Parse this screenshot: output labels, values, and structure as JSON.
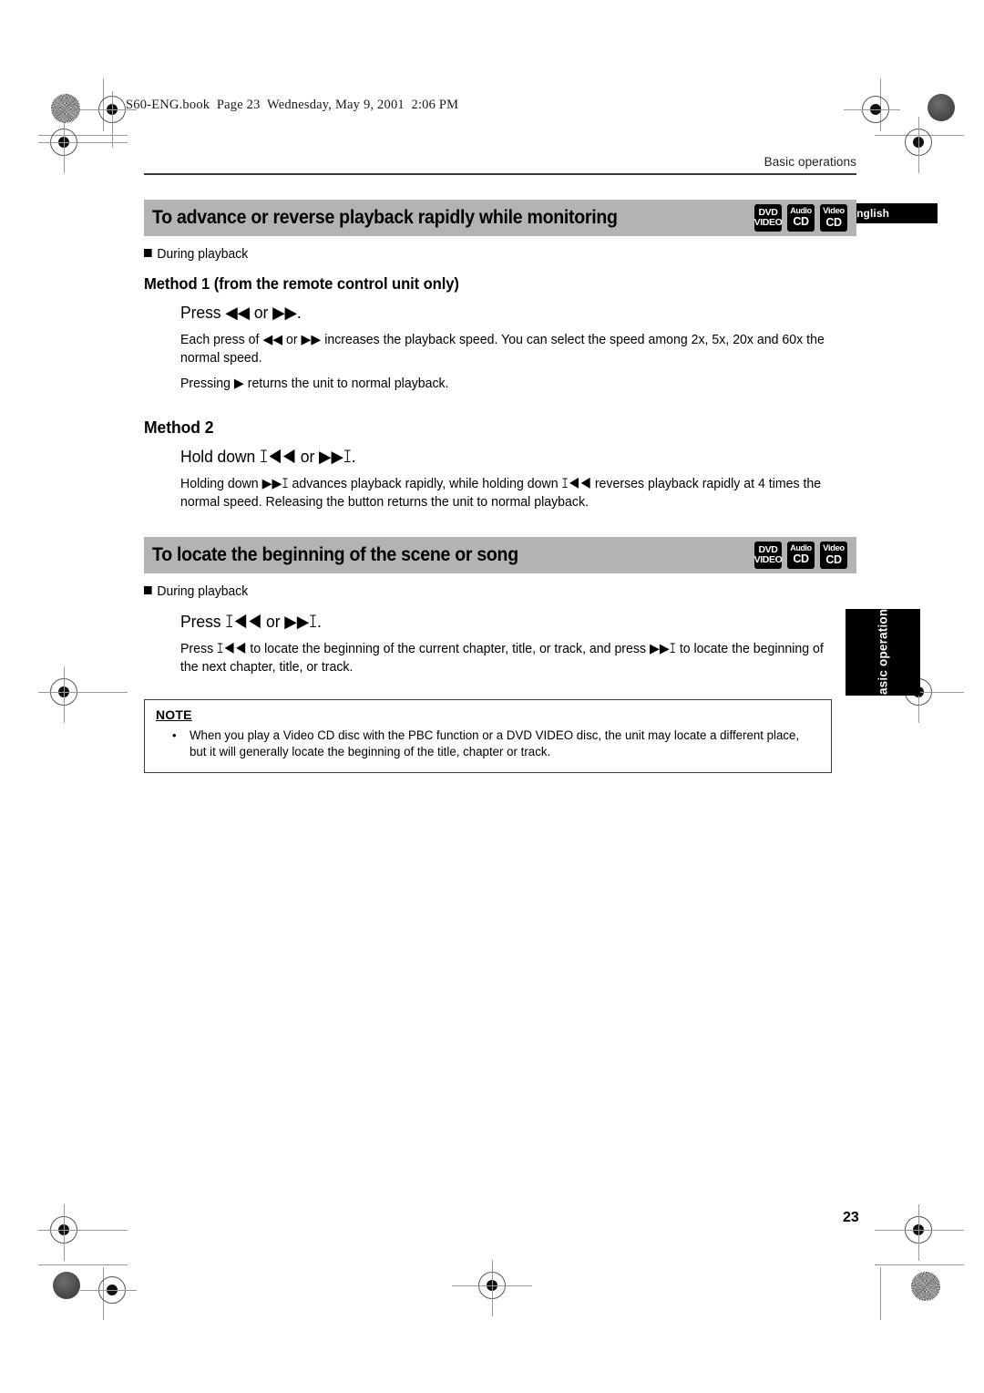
{
  "scan": {
    "header_line": "S60-ENG.book  Page 23  Wednesday, May 9, 2001  2:06 PM"
  },
  "page": {
    "running_head": "Basic operations",
    "page_number": "23",
    "language_tab": "English",
    "side_tab": "Basic operations"
  },
  "disc_icons": [
    {
      "name": "dvd-video",
      "line1": "DVD",
      "line2": "VIDEO"
    },
    {
      "name": "audio-cd",
      "line1": "Audio",
      "line2": "CD"
    },
    {
      "name": "video-cd",
      "line1": "Video",
      "line2": "CD"
    }
  ],
  "sections": [
    {
      "title": "To advance or reverse playback rapidly while monitoring",
      "condition": "During playback",
      "methods": [
        {
          "heading": "Method 1 (from the remote control unit only)",
          "step": "Press ◀◀ or ▶▶.",
          "paragraphs": [
            "Each press of ◀◀ or ▶▶ increases the playback speed. You can select the speed among 2x, 5x, 20x and 60x the normal speed.",
            "Pressing ▶ returns the unit to normal playback."
          ]
        },
        {
          "heading": "Method 2",
          "step": "Hold down ꕯ◀◀ or ▶▶ꕯ.",
          "paragraphs": [
            "Holding down ▶▶ꕯ advances playback rapidly, while holding down ꕯ◀◀ reverses playback rapidly at 4 times the normal speed. Releasing the button returns the unit to normal playback."
          ]
        }
      ]
    },
    {
      "title": "To locate the beginning of the scene or song",
      "condition": "During playback",
      "step": "Press ꕯ◀◀ or ▶▶ꕯ.",
      "paragraphs": [
        "Press ꕯ◀◀ to locate the beginning of the current chapter, title, or track, and press ▶▶ꕯ to locate the beginning of the next chapter, title, or track."
      ]
    }
  ],
  "note": {
    "label": "NOTE",
    "bullet": "•",
    "text": "When you play a Video CD disc with the PBC function or a DVD VIDEO disc, the unit may locate a different place, but it will generally locate the beginning of the title, chapter or track."
  }
}
